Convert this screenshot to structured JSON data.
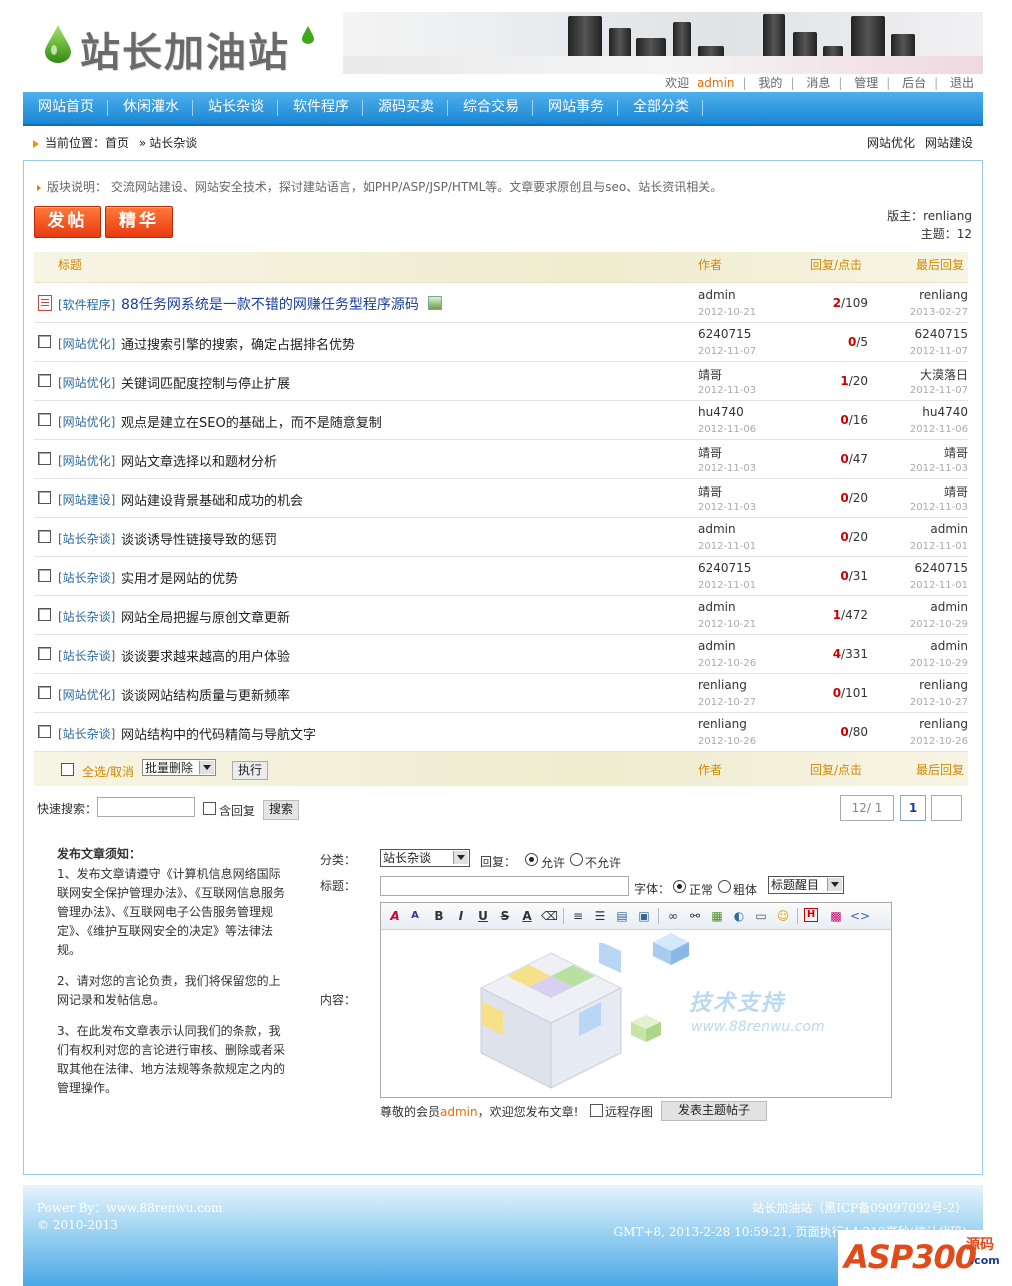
{
  "header": {
    "logo_text": "站长加油站",
    "usernav": {
      "welcome": "欢迎",
      "username": "admin",
      "links": [
        "我的",
        "消息",
        "管理",
        "后台",
        "退出"
      ]
    }
  },
  "nav": {
    "items": [
      "网站首页",
      "休闲灌水",
      "站长杂谈",
      "软件程序",
      "源码买卖",
      "综合交易",
      "网站事务",
      "全部分类"
    ]
  },
  "breadcrumb": {
    "label": "当前位置：",
    "home": "首页",
    "sep": "»",
    "current": "站长杂谈",
    "right_links": [
      "网站优化",
      "网站建设"
    ]
  },
  "board": {
    "description": "版块说明： 交流网站建设、网站安全技术，探讨建站语言，如PHP/ASP/JSP/HTML等。文章要求原创且与seo、站长资讯相关。",
    "post_button": "发帖",
    "best_button": "精华",
    "moderator": "版主：renliang",
    "topics": "主题：12"
  },
  "table": {
    "headers": {
      "title": "标题",
      "author": "作者",
      "reply_click": "回复/点击",
      "last_reply": "最后回复"
    },
    "rows": [
      {
        "cat": "[软件程序]",
        "title": "88任务网系统是一款不错的网赚任务型程序源码",
        "author": "admin",
        "date": "2012-10-21",
        "replies": "2",
        "clicks": "/109",
        "last_user": "renliang",
        "last_date": "2013-02-27"
      },
      {
        "cat": "[网站优化]",
        "title": "通过搜索引擎的搜索，确定占据排名优势",
        "author": "6240715",
        "date": "2012-11-07",
        "replies": "0",
        "clicks": "/5",
        "last_user": "6240715",
        "last_date": "2012-11-07"
      },
      {
        "cat": "[网站优化]",
        "title": "关键词匹配度控制与停止扩展",
        "author": "靖哥",
        "date": "2012-11-03",
        "replies": "1",
        "clicks": "/20",
        "last_user": "大漠落日",
        "last_date": "2012-11-07"
      },
      {
        "cat": "[网站优化]",
        "title": "观点是建立在SEO的基础上，而不是随意复制",
        "author": "hu4740",
        "date": "2012-11-06",
        "replies": "0",
        "clicks": "/16",
        "last_user": "hu4740",
        "last_date": "2012-11-06"
      },
      {
        "cat": "[网站优化]",
        "title": "网站文章选择以和题材分析",
        "author": "靖哥",
        "date": "2012-11-03",
        "replies": "0",
        "clicks": "/47",
        "last_user": "靖哥",
        "last_date": "2012-11-03"
      },
      {
        "cat": "[网站建设]",
        "title": "网站建设背景基础和成功的机会",
        "author": "靖哥",
        "date": "2012-11-03",
        "replies": "0",
        "clicks": "/20",
        "last_user": "靖哥",
        "last_date": "2012-11-03"
      },
      {
        "cat": "[站长杂谈]",
        "title": "谈谈诱导性链接导致的惩罚",
        "author": "admin",
        "date": "2012-11-01",
        "replies": "0",
        "clicks": "/20",
        "last_user": "admin",
        "last_date": "2012-11-01"
      },
      {
        "cat": "[站长杂谈]",
        "title": "实用才是网站的优势",
        "author": "6240715",
        "date": "2012-11-01",
        "replies": "0",
        "clicks": "/31",
        "last_user": "6240715",
        "last_date": "2012-11-01"
      },
      {
        "cat": "[站长杂谈]",
        "title": "网站全局把握与原创文章更新",
        "author": "admin",
        "date": "2012-10-21",
        "replies": "1",
        "clicks": "/472",
        "last_user": "admin",
        "last_date": "2012-10-29"
      },
      {
        "cat": "[站长杂谈]",
        "title": "谈谈要求越来越高的用户体验",
        "author": "admin",
        "date": "2012-10-26",
        "replies": "4",
        "clicks": "/331",
        "last_user": "admin",
        "last_date": "2012-10-29"
      },
      {
        "cat": "[网站优化]",
        "title": "谈谈网站结构质量与更新频率",
        "author": "renliang",
        "date": "2012-10-27",
        "replies": "0",
        "clicks": "/101",
        "last_user": "renliang",
        "last_date": "2012-10-27"
      },
      {
        "cat": "[站长杂谈]",
        "title": "网站结构中的代码精简与导航文字",
        "author": "renliang",
        "date": "2012-10-26",
        "replies": "0",
        "clicks": "/80",
        "last_user": "renliang",
        "last_date": "2012-10-26"
      }
    ],
    "footer": {
      "select_all": "全选/取消",
      "batch_select": "批量删除",
      "execute": "执行",
      "author": "作者",
      "reply_click": "回复/点击",
      "last_reply": "最后回复"
    }
  },
  "search": {
    "label": "快速搜索：",
    "include_reply": "含回复",
    "button": "搜索"
  },
  "pager": {
    "info": "12/ 1",
    "current": "1"
  },
  "notice": {
    "title": "发布文章须知：",
    "p1": "1、发布文章请遵守《计算机信息网络国际联网安全保护管理办法》、《互联网信息服务管理办法》、《互联网电子公告服务管理规定》、《维护互联网安全的决定》等法律法规。",
    "p2": "2、请对您的言论负责，我们将保留您的上网记录和发帖信息。",
    "p3": "3、在此发布文章表示认同我们的条款，我们有权利对您的言论进行审核、删除或者采取其他在法律、地方法规等条款规定之内的管理操作。"
  },
  "form": {
    "category_label": "分类：",
    "category_value": "站长杂谈",
    "reply_label": "回复：",
    "reply_allow": "允许",
    "reply_deny": "不允许",
    "title_label": "标题：",
    "font_label": "字体：",
    "font_normal": "正常",
    "font_bold": "粗体",
    "title_style": "标题醒目",
    "content_label": "内容：",
    "watermark_cn": "技术支持",
    "watermark_url": "www.88renwu.com",
    "welcome_prefix": "尊敬的会员",
    "welcome_user": "admin",
    "welcome_suffix": "，欢迎您发布文章!",
    "remote_image": "远程存图",
    "submit": "发表主题帖子"
  },
  "footer": {
    "powered": "Power By：www.88renwu.com",
    "copyright": "© 2010-2013",
    "site": "站长加油站（黑ICP备09097092号-2）",
    "stats": "GMT+8, 2013-2-28 10:59:21, 页面执行14.219毫秒(统计代码)"
  },
  "watermark": {
    "logo": "ASP300",
    "cn": "源码",
    "com": ".com"
  }
}
